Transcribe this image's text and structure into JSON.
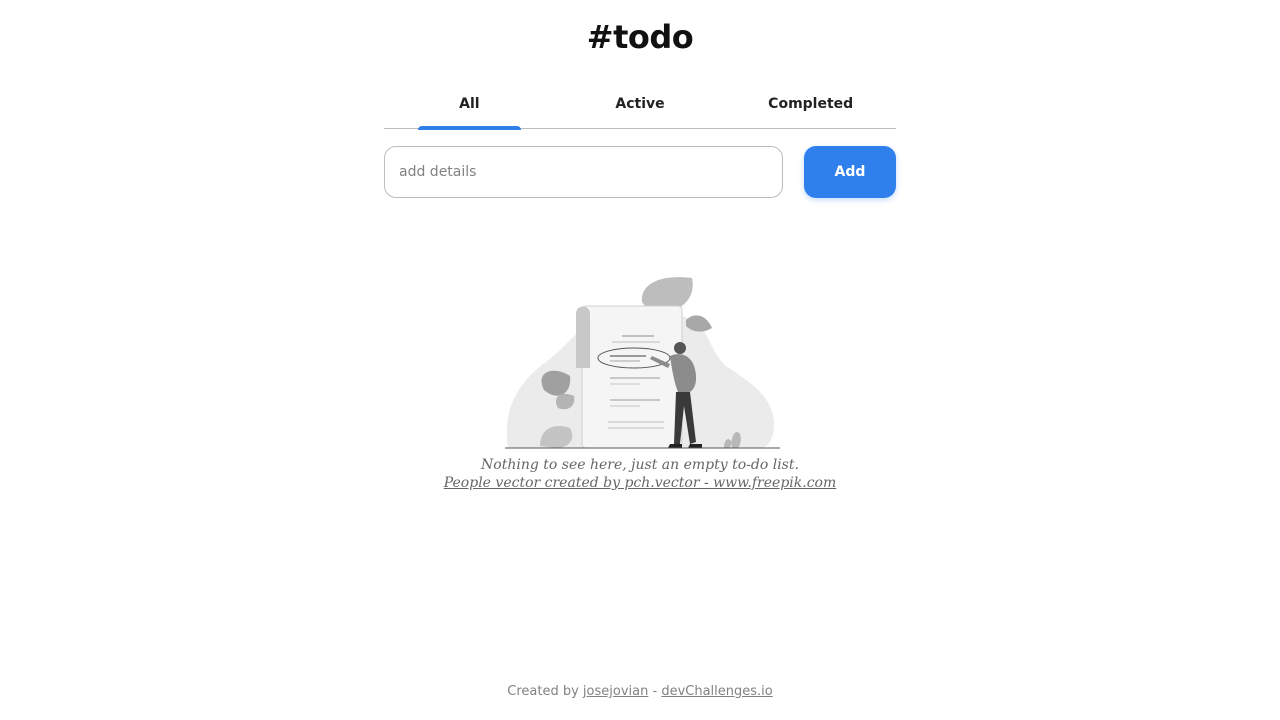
{
  "header": {
    "title": "#todo"
  },
  "tabs": [
    {
      "label": "All",
      "active": true
    },
    {
      "label": "Active",
      "active": false
    },
    {
      "label": "Completed",
      "active": false
    }
  ],
  "add_form": {
    "input_value": "",
    "input_placeholder": "add details",
    "button_label": "Add"
  },
  "empty_state": {
    "message": "Nothing to see here, just an empty to-do list.",
    "credit": "People vector created by pch.vector - www.freepik.com",
    "illustration_icon": "person-with-todo-list-illustration"
  },
  "footer": {
    "prefix": "Created by ",
    "author": "josejovian",
    "separator": " - ",
    "site": "devChallenges.io"
  },
  "colors": {
    "accent": "#2f80ed",
    "border": "#bdbdbd",
    "muted_text": "#828282"
  }
}
